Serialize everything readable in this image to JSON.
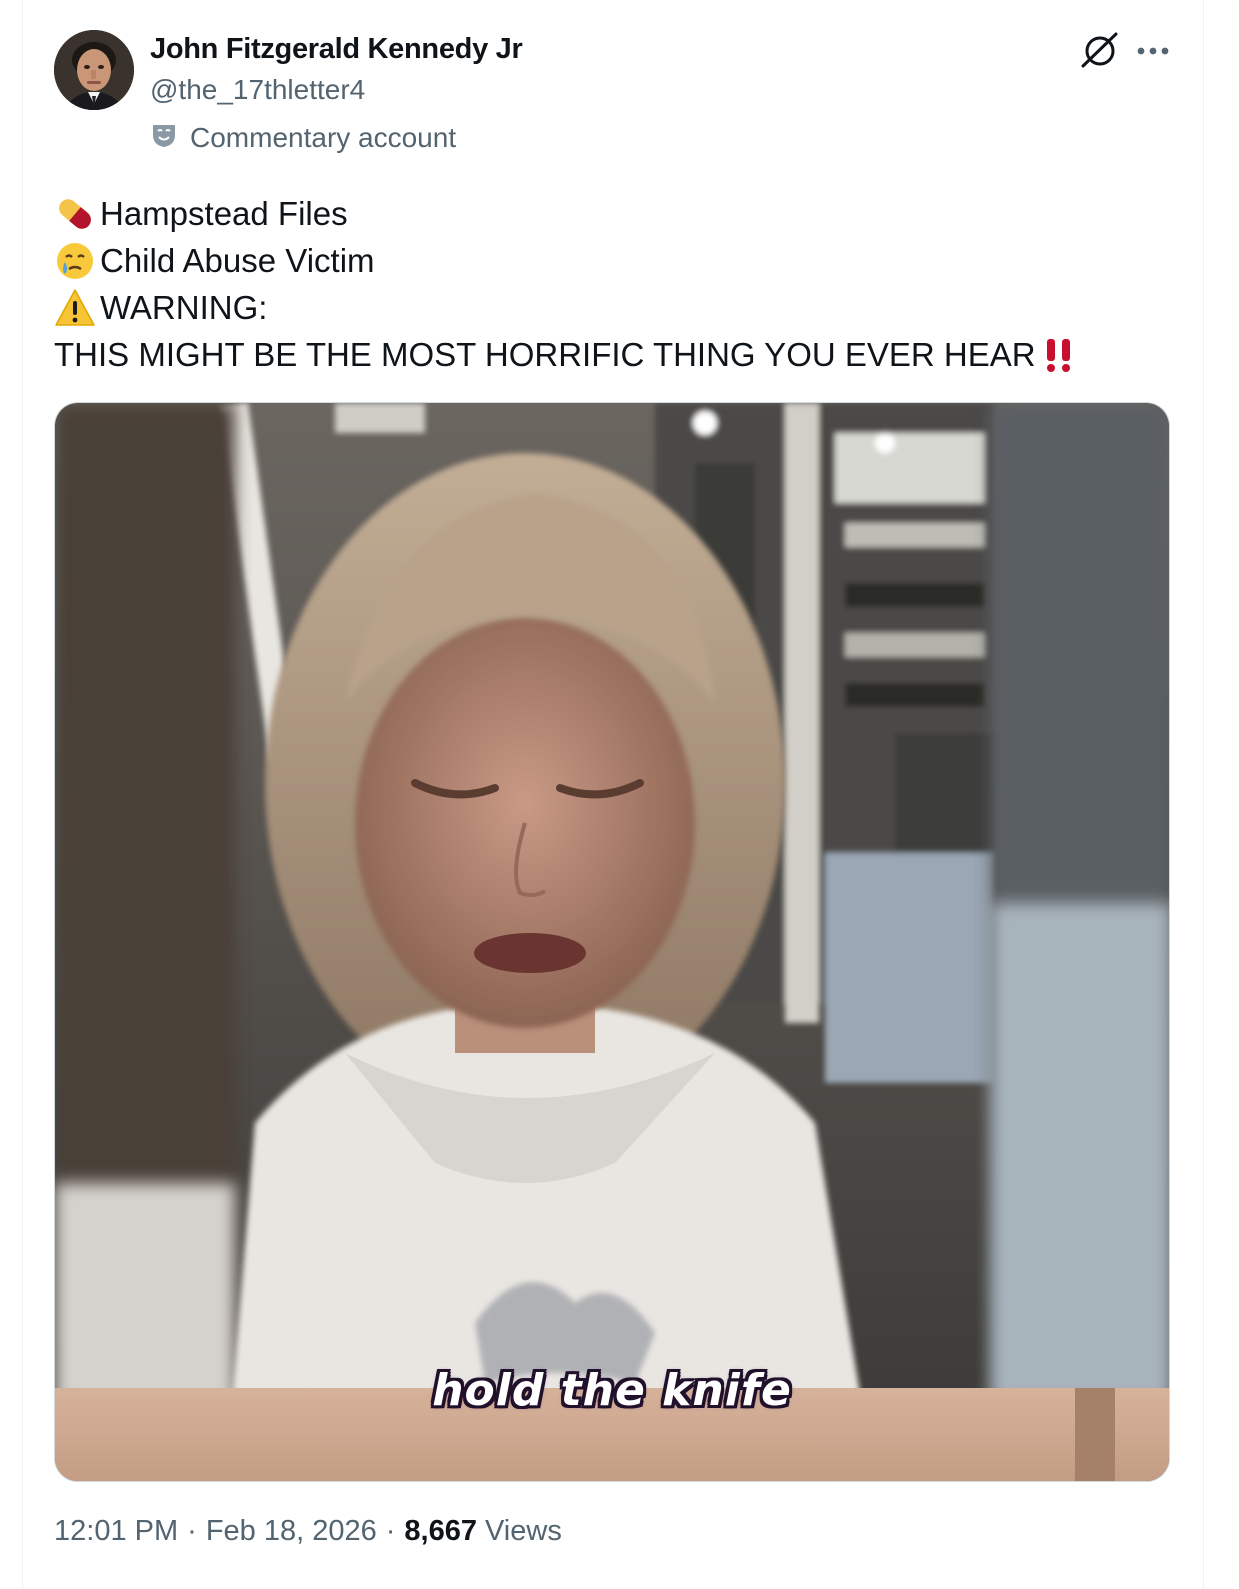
{
  "author": {
    "display_name": "John Fitzgerald Kennedy Jr",
    "handle": "@the_17thletter4",
    "label": "Commentary account"
  },
  "tweet": {
    "lines": [
      {
        "emoji": "pill-icon",
        "text": "Hampstead Files"
      },
      {
        "emoji": "crying-face-icon",
        "text": "Child Abuse Victim"
      },
      {
        "emoji": "warning-icon",
        "text": "WARNING:"
      },
      {
        "emoji": "",
        "text": "THIS MIGHT BE THE MOST HORRIFIC THING YOU EVER HEAR",
        "trailing_emoji": "double-exclamation-icon"
      }
    ]
  },
  "media": {
    "type": "video",
    "caption_overlay": "hold the knife"
  },
  "meta": {
    "time": "12:01 PM",
    "date": "Feb 18, 2026",
    "views_count": "8,667",
    "views_label": "Views"
  },
  "colors": {
    "text_primary": "#0f1419",
    "text_secondary": "#536471",
    "border": "#cfd9de",
    "exclamation_red": "#c8102e"
  }
}
